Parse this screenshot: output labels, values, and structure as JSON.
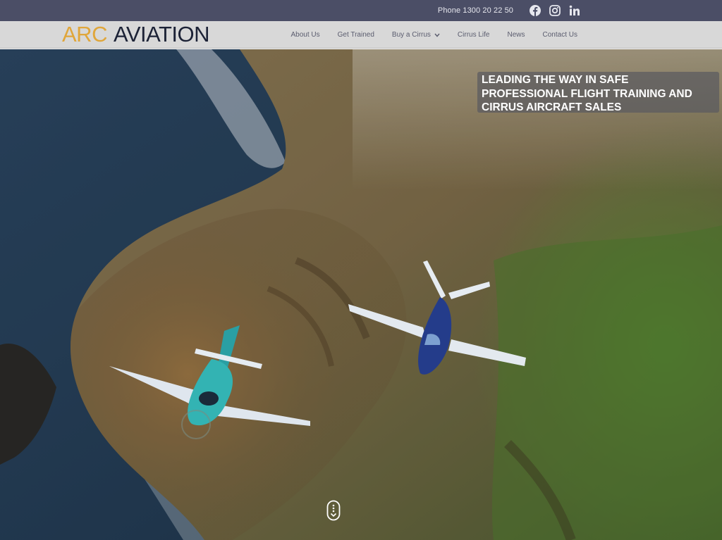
{
  "topbar": {
    "phone": "Phone 1300 20 22 50",
    "social": [
      "facebook-icon",
      "instagram-icon",
      "linkedin-icon"
    ]
  },
  "brand": {
    "logo_arc": "ARC",
    "logo_aviation": "AVIATION",
    "accent_color": "#e0a63a",
    "dark_color": "#1c2236"
  },
  "nav": {
    "items": [
      {
        "label": "About Us"
      },
      {
        "label": "Get Trained"
      },
      {
        "label": "Buy a Cirrus",
        "has_dropdown": true
      },
      {
        "label": "Cirrus Life"
      },
      {
        "label": "News"
      },
      {
        "label": "Contact Us"
      }
    ]
  },
  "hero": {
    "headline": "LEADING THE WAY IN SAFE PROFESSIONAL FLIGHT TRAINING AND CIRRUS AIRCRAFT SALES",
    "scroll_icon": "scroll-down-icon"
  }
}
